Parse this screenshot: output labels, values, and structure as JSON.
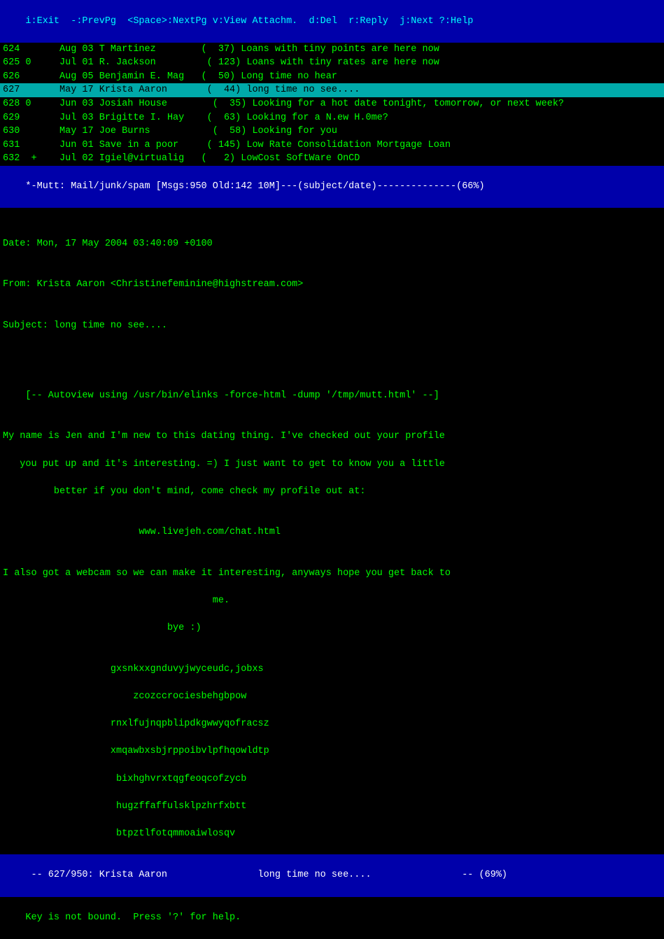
{
  "topbar": {
    "text": "i:Exit  -:PrevPg  <Space>:NextPg v:View Attachm.  d:Del  r:Reply  j:Next ?:Help"
  },
  "emailList": [
    {
      "id": "624",
      "flag": " ",
      "date": "Aug 03",
      "sender": "T Martinez",
      "size": "  37",
      "subject": "Loans with tiny points are here now"
    },
    {
      "id": "625 0",
      "flag": " ",
      "date": "Jul 01",
      "sender": "R. Jackson",
      "size": " 123",
      "subject": "Loans with tiny rates are here now"
    },
    {
      "id": "626",
      "flag": " ",
      "date": "Aug 05",
      "sender": "Benjamin E. Mag",
      "size": "  50",
      "subject": "Long time no hear"
    },
    {
      "id": "627",
      "flag": " ",
      "date": "May 17",
      "sender": "Krista Aaron",
      "size": "  44",
      "subject": "long time no see....",
      "highlighted": true
    },
    {
      "id": "628 0",
      "flag": " ",
      "date": "Jun 03",
      "sender": "Josiah House",
      "size": "  35",
      "subject": "Looking for a hot date tonight, tomorrow, or next week?"
    },
    {
      "id": "629",
      "flag": " ",
      "date": "Jul 03",
      "sender": "Brigitte I. Hay",
      "size": "  63",
      "subject": "Looking for a N.ew H.0me?"
    },
    {
      "id": "630",
      "flag": " ",
      "date": "May 17",
      "sender": "Joe Burns",
      "size": "  58",
      "subject": "Looking for you"
    },
    {
      "id": "631",
      "flag": " ",
      "date": "Jun 01",
      "sender": "Save in a poor",
      "size": " 145",
      "subject": "Low Rate Consolidation Mortgage Loan"
    },
    {
      "id": "632",
      "flag": "+",
      "date": "Jul 02",
      "sender": "Igiel@virtualig",
      "size": "   2",
      "subject": "LowCost SoftWare OnCD"
    }
  ],
  "statusBar": {
    "text": "*-Mutt: Mail/junk/spam [Msgs:950 Old:142 10M]---(subject/date)--------------(66%)"
  },
  "headers": {
    "date": "Date: Mon, 17 May 2004 03:40:09 +0100",
    "from": "From: Krista Aaron <Christinefeminine@highstream.com>",
    "subject": "Subject: long time no see...."
  },
  "autoview": "[-- Autoview using /usr/bin/elinks -force-html -dump '/tmp/mutt.html' --]",
  "body": {
    "line1": "My name is Jen and I'm new to this dating thing. I've checked out your profile",
    "line2": "   you put up and it's interesting. =) I just want to get to know you a little",
    "line3": "         better if you don't mind, come check my profile out at:",
    "blank1": "",
    "url": "                        www.livejeh.com/chat.html",
    "blank2": "",
    "line4": "I also got a webcam so we can make it interesting, anyways hope you get back to",
    "line5": "                                     me.",
    "line6": "                             bye :)",
    "blank3": "",
    "spam1": "                   gxsnkxxgnduvyjwyceudc,jobxs",
    "spam2": "                       zcozccrociesbehgbpow",
    "spam3": "                   rnxlfujnqpblipdkgwwyqofracsz",
    "spam4": "                   xmqawbxsbjrppoibvlpfhqowldtp",
    "spam5": "                    bixhghvrxtqgfeoqcofzycb",
    "spam6": "                    hugzffaffulsklpzhrfxbtt",
    "spam7": "                    btpztlfotqmmoaiwlosqv"
  },
  "bottomStatus": {
    "text": " -- 627/950: Krista Aaron                long time no see....                -- (69%)"
  },
  "bottomBar": {
    "text": "Key is not bound.  Press '?' for help."
  }
}
